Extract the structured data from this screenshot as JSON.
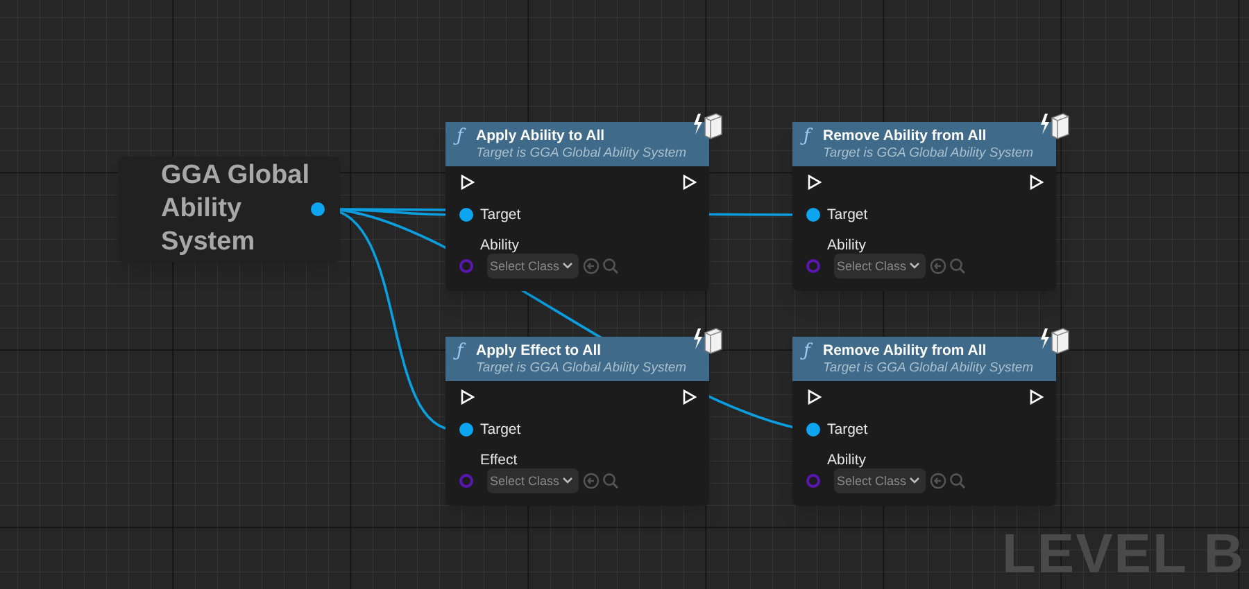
{
  "variable_node": {
    "title": "GGA Global Ability System"
  },
  "function_nodes": [
    {
      "icon": "ƒ",
      "title": "Apply Ability to All",
      "subtitle": "Target is GGA Global Ability System",
      "target_label": "Target",
      "class_label": "Ability",
      "class_dropdown": "Select Class"
    },
    {
      "icon": "ƒ",
      "title": "Remove Ability from All",
      "subtitle": "Target is GGA Global Ability System",
      "target_label": "Target",
      "class_label": "Ability",
      "class_dropdown": "Select Class"
    },
    {
      "icon": "ƒ",
      "title": "Apply Effect to All",
      "subtitle": "Target is GGA Global Ability System",
      "target_label": "Target",
      "class_label": "Effect",
      "class_dropdown": "Select Class"
    },
    {
      "icon": "ƒ",
      "title": "Remove Ability from All",
      "subtitle": "Target is GGA Global Ability System",
      "target_label": "Target",
      "class_label": "Ability",
      "class_dropdown": "Select Class"
    }
  ],
  "graph_label": "LEVEL B"
}
